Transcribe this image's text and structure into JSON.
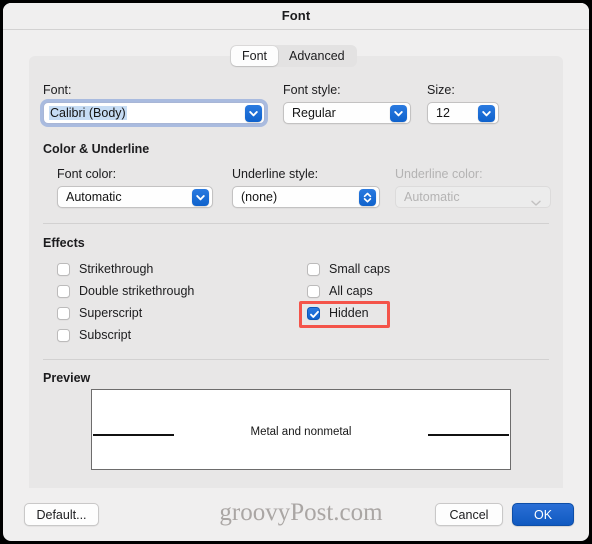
{
  "window": {
    "title": "Font"
  },
  "tabs": [
    {
      "label": "Font",
      "active": true
    },
    {
      "label": "Advanced",
      "active": false
    }
  ],
  "font_section": {
    "font_label": "Font:",
    "font_value": "Calibri (Body)",
    "font_style_label": "Font style:",
    "font_style_value": "Regular",
    "size_label": "Size:",
    "size_value": "12"
  },
  "color_underline": {
    "heading": "Color & Underline",
    "font_color_label": "Font color:",
    "font_color_value": "Automatic",
    "underline_style_label": "Underline style:",
    "underline_style_value": "(none)",
    "underline_color_label": "Underline color:",
    "underline_color_value": "Automatic",
    "underline_color_disabled": true
  },
  "effects": {
    "heading": "Effects",
    "left_column": [
      {
        "label": "Strikethrough",
        "checked": false
      },
      {
        "label": "Double strikethrough",
        "checked": false
      },
      {
        "label": "Superscript",
        "checked": false
      },
      {
        "label": "Subscript",
        "checked": false
      }
    ],
    "right_column": [
      {
        "label": "Small caps",
        "checked": false
      },
      {
        "label": "All caps",
        "checked": false
      },
      {
        "label": "Hidden",
        "checked": true,
        "highlighted": true
      }
    ]
  },
  "preview": {
    "heading": "Preview",
    "text": "Metal and nonmetal"
  },
  "footer": {
    "default_label": "Default...",
    "cancel_label": "Cancel",
    "ok_label": "OK",
    "watermark": "groovyPost.com"
  },
  "colors": {
    "accent_blue": "#1059c0",
    "highlight_red": "#f4544a",
    "window_bg": "#f0efef",
    "panel_bg": "#e8e7e7"
  }
}
